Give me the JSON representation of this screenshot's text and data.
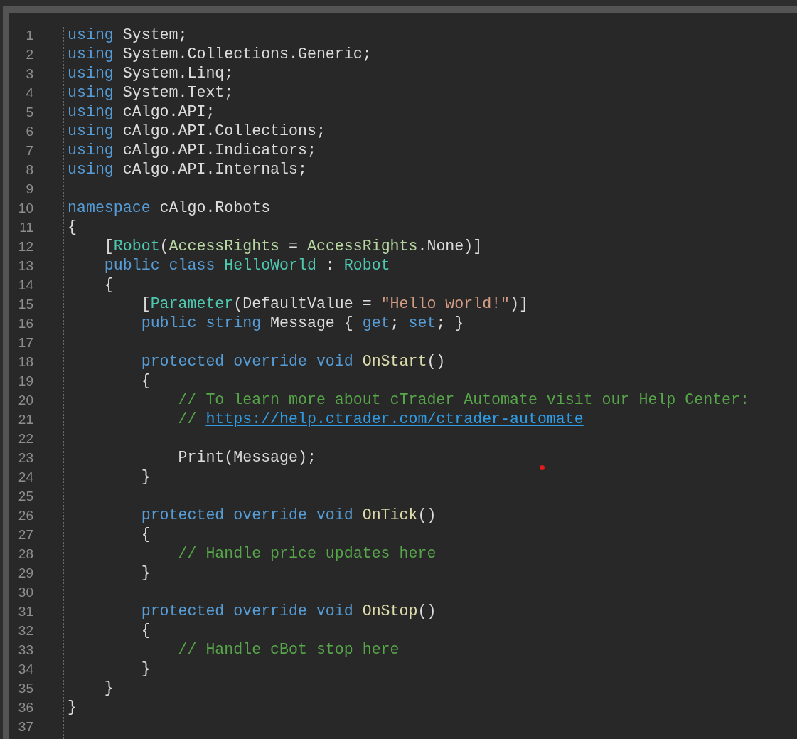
{
  "editor": {
    "lines": [
      {
        "number": "1",
        "tokens": [
          {
            "kind": "keyword",
            "text": "using"
          },
          {
            "kind": "plain",
            "text": " System;"
          }
        ]
      },
      {
        "number": "2",
        "tokens": [
          {
            "kind": "keyword",
            "text": "using"
          },
          {
            "kind": "plain",
            "text": " System.Collections.Generic;"
          }
        ]
      },
      {
        "number": "3",
        "tokens": [
          {
            "kind": "keyword",
            "text": "using"
          },
          {
            "kind": "plain",
            "text": " System.Linq;"
          }
        ]
      },
      {
        "number": "4",
        "tokens": [
          {
            "kind": "keyword",
            "text": "using"
          },
          {
            "kind": "plain",
            "text": " System.Text;"
          }
        ]
      },
      {
        "number": "5",
        "tokens": [
          {
            "kind": "keyword",
            "text": "using"
          },
          {
            "kind": "plain",
            "text": " cAlgo.API;"
          }
        ]
      },
      {
        "number": "6",
        "tokens": [
          {
            "kind": "keyword",
            "text": "using"
          },
          {
            "kind": "plain",
            "text": " cAlgo.API.Collections;"
          }
        ]
      },
      {
        "number": "7",
        "tokens": [
          {
            "kind": "keyword",
            "text": "using"
          },
          {
            "kind": "plain",
            "text": " cAlgo.API.Indicators;"
          }
        ]
      },
      {
        "number": "8",
        "tokens": [
          {
            "kind": "keyword",
            "text": "using"
          },
          {
            "kind": "plain",
            "text": " cAlgo.API.Internals;"
          }
        ]
      },
      {
        "number": "9"
      },
      {
        "number": "10",
        "tokens": [
          {
            "kind": "keyword",
            "text": "namespace"
          },
          {
            "kind": "plain",
            "text": " cAlgo.Robots"
          }
        ]
      },
      {
        "number": "11",
        "tokens": [
          {
            "kind": "plain",
            "text": "{"
          }
        ]
      },
      {
        "number": "12",
        "tokens": [
          {
            "kind": "plain",
            "text": "    ["
          },
          {
            "kind": "type",
            "text": "Robot"
          },
          {
            "kind": "plain",
            "text": "("
          },
          {
            "kind": "enum",
            "text": "AccessRights"
          },
          {
            "kind": "plain",
            "text": " = "
          },
          {
            "kind": "enum",
            "text": "AccessRights"
          },
          {
            "kind": "plain",
            "text": ".None)]"
          }
        ]
      },
      {
        "number": "13",
        "tokens": [
          {
            "kind": "keyword",
            "text": "    public class "
          },
          {
            "kind": "type",
            "text": "HelloWorld"
          },
          {
            "kind": "plain",
            "text": " : "
          },
          {
            "kind": "type",
            "text": "Robot"
          }
        ]
      },
      {
        "number": "14",
        "tokens": [
          {
            "kind": "plain",
            "text": "    {"
          }
        ]
      },
      {
        "number": "15",
        "tokens": [
          {
            "kind": "plain",
            "text": "        ["
          },
          {
            "kind": "type",
            "text": "Parameter"
          },
          {
            "kind": "plain",
            "text": "(DefaultValue = "
          },
          {
            "kind": "string",
            "text": "\"Hello world!\""
          },
          {
            "kind": "plain",
            "text": ")]"
          }
        ]
      },
      {
        "number": "16",
        "tokens": [
          {
            "kind": "keyword",
            "text": "        public string"
          },
          {
            "kind": "plain",
            "text": " Message { "
          },
          {
            "kind": "keyword",
            "text": "get"
          },
          {
            "kind": "plain",
            "text": "; "
          },
          {
            "kind": "keyword",
            "text": "set"
          },
          {
            "kind": "plain",
            "text": "; }"
          }
        ]
      },
      {
        "number": "17"
      },
      {
        "number": "18",
        "tokens": [
          {
            "kind": "keyword",
            "text": "        protected override void "
          },
          {
            "kind": "method",
            "text": "OnStart"
          },
          {
            "kind": "plain",
            "text": "()"
          }
        ]
      },
      {
        "number": "19",
        "tokens": [
          {
            "kind": "plain",
            "text": "        {"
          }
        ]
      },
      {
        "number": "20",
        "tokens": [
          {
            "kind": "comment",
            "text": "            // To learn more about cTrader Automate visit our Help Center:"
          }
        ]
      },
      {
        "number": "21",
        "tokens": [
          {
            "kind": "comment",
            "text": "            // "
          },
          {
            "kind": "link",
            "text": "https://help.ctrader.com/ctrader-automate"
          }
        ]
      },
      {
        "number": "22"
      },
      {
        "number": "23",
        "tokens": [
          {
            "kind": "plain",
            "text": "            Print(Message);"
          }
        ]
      },
      {
        "number": "24",
        "tokens": [
          {
            "kind": "plain",
            "text": "        }"
          }
        ]
      },
      {
        "number": "25"
      },
      {
        "number": "26",
        "tokens": [
          {
            "kind": "keyword",
            "text": "        protected override void "
          },
          {
            "kind": "method",
            "text": "OnTick"
          },
          {
            "kind": "plain",
            "text": "()"
          }
        ]
      },
      {
        "number": "27",
        "tokens": [
          {
            "kind": "plain",
            "text": "        {"
          }
        ]
      },
      {
        "number": "28",
        "tokens": [
          {
            "kind": "comment",
            "text": "            // Handle price updates here"
          }
        ]
      },
      {
        "number": "29",
        "tokens": [
          {
            "kind": "plain",
            "text": "        }"
          }
        ]
      },
      {
        "number": "30"
      },
      {
        "number": "31",
        "tokens": [
          {
            "kind": "keyword",
            "text": "        protected override void "
          },
          {
            "kind": "method",
            "text": "OnStop"
          },
          {
            "kind": "plain",
            "text": "()"
          }
        ]
      },
      {
        "number": "32",
        "tokens": [
          {
            "kind": "plain",
            "text": "        {"
          }
        ]
      },
      {
        "number": "33",
        "tokens": [
          {
            "kind": "comment",
            "text": "            // Handle cBot stop here"
          }
        ]
      },
      {
        "number": "34",
        "tokens": [
          {
            "kind": "plain",
            "text": "        }"
          }
        ]
      },
      {
        "number": "35",
        "tokens": [
          {
            "kind": "plain",
            "text": "    }"
          }
        ]
      },
      {
        "number": "36",
        "tokens": [
          {
            "kind": "plain",
            "text": "}"
          }
        ]
      },
      {
        "number": "37"
      }
    ],
    "marker": {
      "color": "#e21b1b"
    }
  }
}
